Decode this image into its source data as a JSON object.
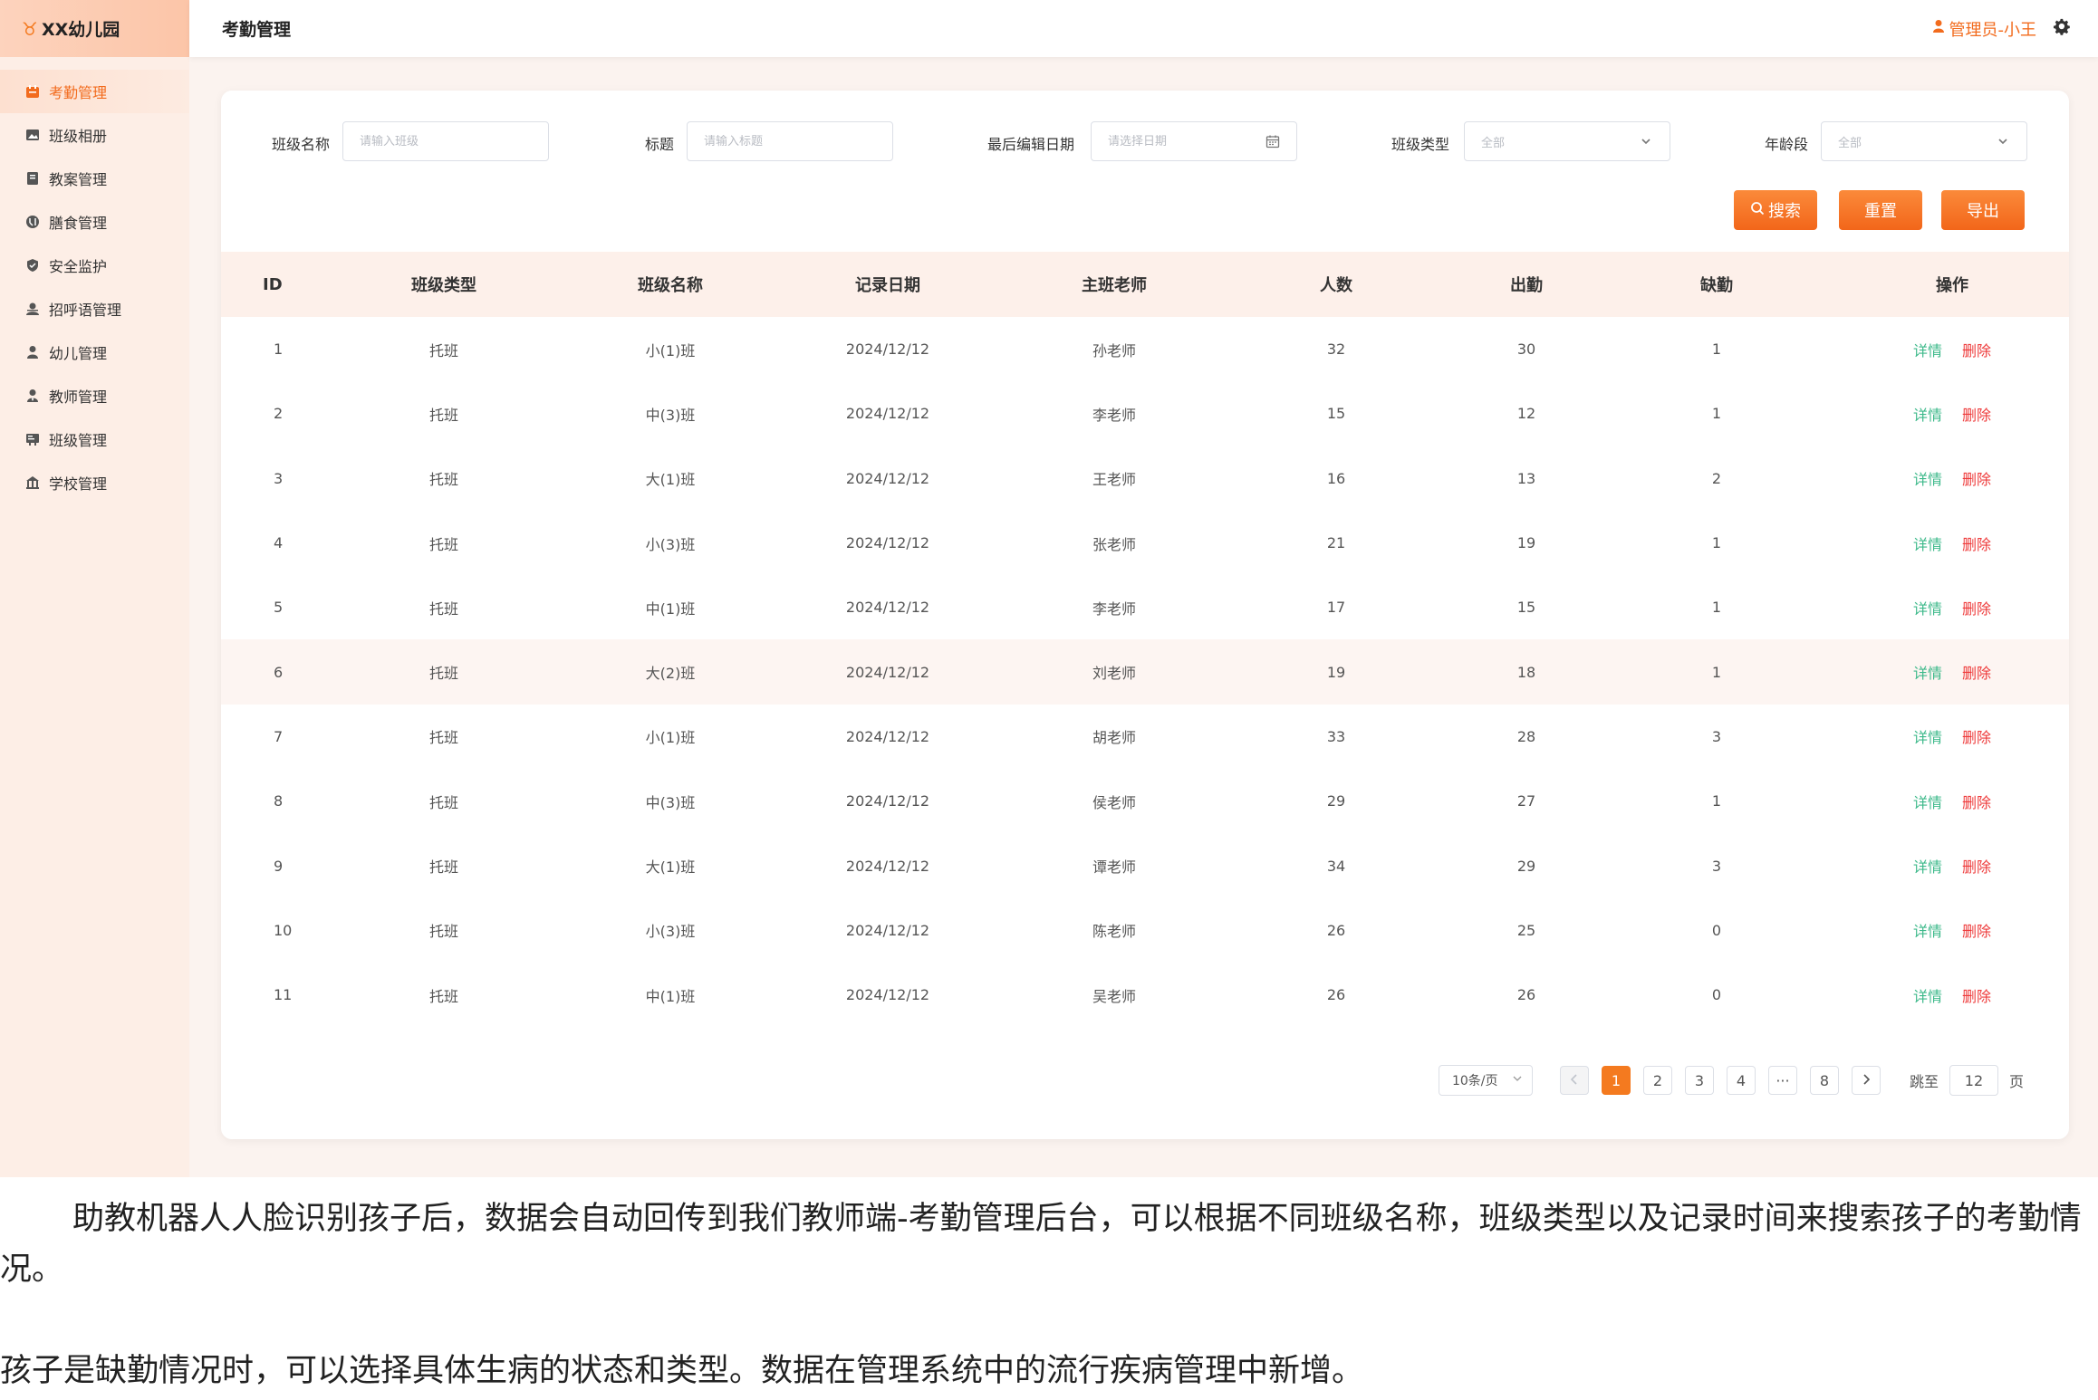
{
  "brand": {
    "icon": "kindergarten-logo-icon",
    "name": "XX幼儿园"
  },
  "topbar": {
    "title": "考勤管理",
    "user": "管理员-小王",
    "user_icon": "user-icon",
    "settings_icon": "gear-icon"
  },
  "sidebar": {
    "items": [
      {
        "label": "考勤管理",
        "icon": "calendar-icon",
        "active": true
      },
      {
        "label": "班级相册",
        "icon": "image-icon",
        "active": false
      },
      {
        "label": "教案管理",
        "icon": "book-icon",
        "active": false
      },
      {
        "label": "膳食管理",
        "icon": "meal-icon",
        "active": false
      },
      {
        "label": "安全监护",
        "icon": "shield-icon",
        "active": false
      },
      {
        "label": "招呼语管理",
        "icon": "greeting-icon",
        "active": false
      },
      {
        "label": "幼儿管理",
        "icon": "child-icon",
        "active": false
      },
      {
        "label": "教师管理",
        "icon": "teacher-icon",
        "active": false
      },
      {
        "label": "班级管理",
        "icon": "class-icon",
        "active": false
      },
      {
        "label": "学校管理",
        "icon": "school-icon",
        "active": false
      }
    ]
  },
  "filters": {
    "class_name": {
      "label": "班级名称",
      "placeholder": "请输入班级"
    },
    "title": {
      "label": "标题",
      "placeholder": "请输入标题"
    },
    "edit_date": {
      "label": "最后编辑日期",
      "placeholder": "请选择日期"
    },
    "class_type": {
      "label": "班级类型",
      "value": "全部"
    },
    "age_group": {
      "label": "年龄段",
      "value": "全部"
    }
  },
  "buttons": {
    "search": "搜索",
    "reset": "重置",
    "export": "导出"
  },
  "table": {
    "headers": [
      "ID",
      "班级类型",
      "班级名称",
      "记录日期",
      "主班老师",
      "人数",
      "出勤",
      "缺勤",
      "操作"
    ],
    "rows": [
      {
        "id": "1",
        "type": "托班",
        "name": "小(1)班",
        "date": "2024/12/12",
        "teacher": "孙老师",
        "count": "32",
        "attend": "30",
        "absent": "1"
      },
      {
        "id": "2",
        "type": "托班",
        "name": "中(3)班",
        "date": "2024/12/12",
        "teacher": "李老师",
        "count": "15",
        "attend": "12",
        "absent": "1"
      },
      {
        "id": "3",
        "type": "托班",
        "name": "大(1)班",
        "date": "2024/12/12",
        "teacher": "王老师",
        "count": "16",
        "attend": "13",
        "absent": "2"
      },
      {
        "id": "4",
        "type": "托班",
        "name": "小(3)班",
        "date": "2024/12/12",
        "teacher": "张老师",
        "count": "21",
        "attend": "19",
        "absent": "1"
      },
      {
        "id": "5",
        "type": "托班",
        "name": "中(1)班",
        "date": "2024/12/12",
        "teacher": "李老师",
        "count": "17",
        "attend": "15",
        "absent": "1"
      },
      {
        "id": "6",
        "type": "托班",
        "name": "大(2)班",
        "date": "2024/12/12",
        "teacher": "刘老师",
        "count": "19",
        "attend": "18",
        "absent": "1"
      },
      {
        "id": "7",
        "type": "托班",
        "name": "小(1)班",
        "date": "2024/12/12",
        "teacher": "胡老师",
        "count": "33",
        "attend": "28",
        "absent": "3"
      },
      {
        "id": "8",
        "type": "托班",
        "name": "中(3)班",
        "date": "2024/12/12",
        "teacher": "侯老师",
        "count": "29",
        "attend": "27",
        "absent": "1"
      },
      {
        "id": "9",
        "type": "托班",
        "name": "大(1)班",
        "date": "2024/12/12",
        "teacher": "谭老师",
        "count": "34",
        "attend": "29",
        "absent": "3"
      },
      {
        "id": "10",
        "type": "托班",
        "name": "小(3)班",
        "date": "2024/12/12",
        "teacher": "陈老师",
        "count": "26",
        "attend": "25",
        "absent": "0"
      },
      {
        "id": "11",
        "type": "托班",
        "name": "中(1)班",
        "date": "2024/12/12",
        "teacher": "吴老师",
        "count": "26",
        "attend": "26",
        "absent": "0"
      }
    ],
    "ops": {
      "detail": "详情",
      "delete": "删除"
    },
    "highlight_row": 6
  },
  "pagination": {
    "page_size": "10条/页",
    "pages": [
      "1",
      "2",
      "3",
      "4",
      "···",
      "8"
    ],
    "current": "1",
    "jump_label": "跳至",
    "jump_value": "12",
    "page_label": "页"
  },
  "colors": {
    "accent": "#f47a1f",
    "detail": "#3cb98a",
    "delete": "#ee3b3b",
    "header_bg": "#fdf0ea"
  },
  "caption": {
    "p1": "助教机器人人脸识别孩子后，数据会自动回传到我们教师端-考勤管理后台，可以根据不同班级名称，班级类型以及记录时间来搜索孩子的考勤情况。",
    "p2": "孩子是缺勤情况时，可以选择具体生病的状态和类型。数据在管理系统中的流行疾病管理中新增。"
  }
}
